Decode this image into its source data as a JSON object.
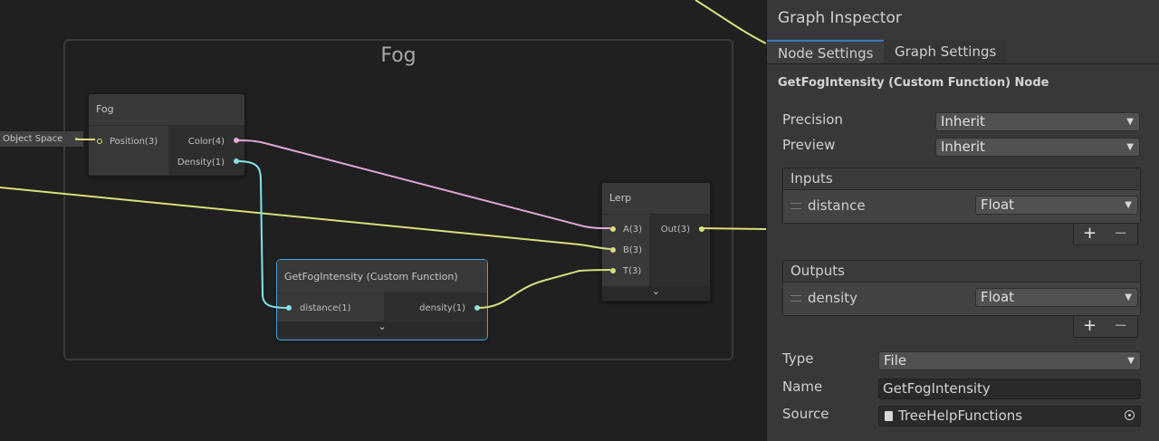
{
  "canvas": {
    "group_title": "Fog",
    "object_space_label": "Object Space",
    "fog_node": {
      "title": "Fog",
      "inputs": [
        "Position(3)"
      ],
      "outputs": [
        "Color(4)",
        "Density(1)"
      ]
    },
    "custom_node": {
      "title": "GetFogIntensity (Custom Function)",
      "inputs": [
        "distance(1)"
      ],
      "outputs": [
        "density(1)"
      ],
      "expand": "⌄"
    },
    "lerp_node": {
      "title": "Lerp",
      "inputs": [
        "A(3)",
        "B(3)",
        "T(3)"
      ],
      "outputs": [
        "Out(3)"
      ],
      "expand": "⌄"
    },
    "colors": {
      "vector3": "#d8df7e",
      "vector4": "#e3a8d6",
      "float": "#84e4e7",
      "selection": "#44aae6"
    }
  },
  "inspector": {
    "title": "Graph Inspector",
    "tabs": [
      "Node Settings",
      "Graph Settings"
    ],
    "active_tab": "Node Settings",
    "node_heading": "GetFogIntensity (Custom Function) Node",
    "precision_label": "Precision",
    "precision_value": "Inherit",
    "preview_label": "Preview",
    "preview_value": "Inherit",
    "inputs": {
      "header": "Inputs",
      "rows": [
        {
          "name": "distance",
          "type": "Float"
        }
      ],
      "add": "+",
      "remove": "−"
    },
    "outputs": {
      "header": "Outputs",
      "rows": [
        {
          "name": "density",
          "type": "Float"
        }
      ],
      "add": "+",
      "remove": "−"
    },
    "type_label": "Type",
    "type_value": "File",
    "name_label": "Name",
    "name_value": "GetFogIntensity",
    "source_label": "Source",
    "source_value": "TreeHelpFunctions",
    "icons": {
      "dropdown": "triangle-down-icon",
      "file": "file-icon",
      "object_picker": "target-icon"
    }
  }
}
